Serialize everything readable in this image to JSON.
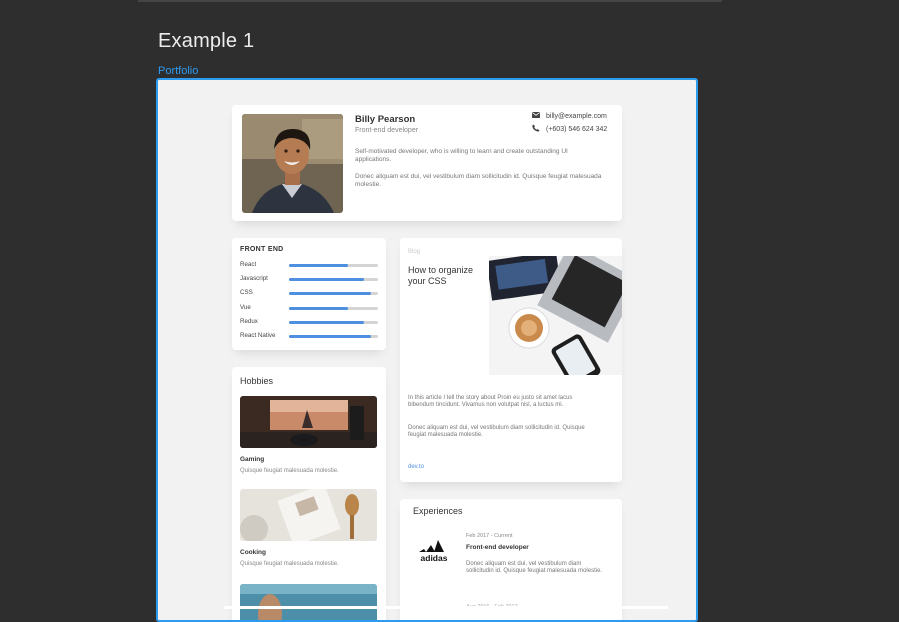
{
  "page": {
    "title": "Example 1",
    "frame_label": "Portfolio"
  },
  "profile": {
    "name": "Billy Pearson",
    "role": "Front-end developer",
    "email": "billy@example.com",
    "phone": "(+603) 546 624 342",
    "bio1": "Self-motivated developer, who is willing to learn and create outstanding UI applications.",
    "bio2": "Donec aliquam est dui, vel vestibulum diam sollicitudin id. Quisque feugiat malesuada molestie."
  },
  "skills": {
    "title": "FRONT END",
    "items": [
      {
        "label": "React",
        "level": 0.66
      },
      {
        "label": "Javascript",
        "level": 0.84
      },
      {
        "label": "CSS",
        "level": 0.92
      },
      {
        "label": "Vue",
        "level": 0.66
      },
      {
        "label": "Redux",
        "level": 0.84
      },
      {
        "label": "React Native",
        "level": 0.92
      }
    ]
  },
  "hobbies": {
    "title": "Hobbies",
    "items": [
      {
        "name": "Gaming",
        "desc": "Quisque feugiat malesuada molestie."
      },
      {
        "name": "Cooking",
        "desc": "Quisque feugiat malesuada molestie."
      }
    ]
  },
  "blog": {
    "tag": "Blog",
    "title": "How to organize your CSS",
    "text1": "In this article I tell the story about Proin eu justo sit amet lacus bibendum tincidunt. Vivamus non volutpat nisl, a luctus mi.",
    "text2": "Donec aliquam est dui, vel vestibulum diam sollicitudin id. Quisque feugiat malesuada molestie.",
    "link": "dev.to"
  },
  "experiences": {
    "title": "Experiences",
    "items": [
      {
        "company": "adidas",
        "date": "Feb 2017 - Current",
        "role": "Front-end developer",
        "desc": "Donec aliquam est dui, vel vestibulum diam sollicitudin id. Quisque feugiat malesuada molestie."
      }
    ],
    "next_date": "Aug 2016 - Feb 2017"
  },
  "colors": {
    "accent": "#2d9bf0",
    "skill_bar": "#4f8fe0",
    "background": "#2e2e2e"
  }
}
